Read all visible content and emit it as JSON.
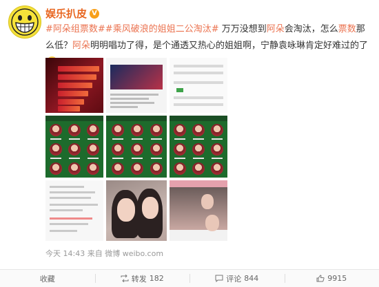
{
  "user": {
    "name": "娱乐扒皮",
    "vip_badge": "V"
  },
  "post": {
    "tag1": "#阿朵组票数#",
    "tag2": "#乘风破浪的姐姐二公淘汰#",
    "seg1": " 万万没想到",
    "hl1": "阿朵",
    "seg2": "会淘汰，怎么",
    "hl2": "票数",
    "seg3": "那么低？",
    "hl3": "阿朵",
    "seg4": "明明唱功了得，是个通透又热心的姐姐啊，宁静袁咏琳肯定好难过的了",
    "emoji": "sad-face-icon"
  },
  "meta": {
    "time": "今天 14:43",
    "source_prefix": "来自",
    "source": "微博 weibo.com"
  },
  "actions": {
    "collect": "收藏",
    "repost_label": "转发",
    "repost_count": "182",
    "comment_label": "评论",
    "comment_count": "844",
    "like_count": "9915"
  },
  "colors": {
    "accent": "#eb7350",
    "name": "#e86722"
  }
}
